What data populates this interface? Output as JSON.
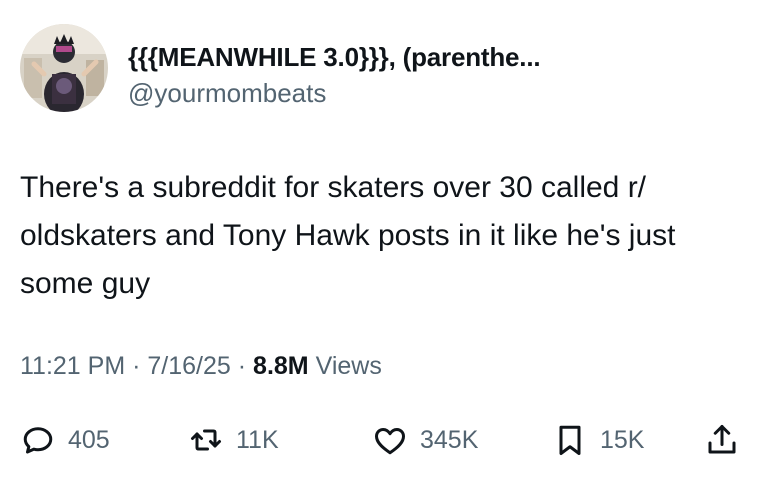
{
  "author": {
    "display_name": "{{{MEANWHILE 3.0}}}, (parenthe...",
    "handle": "@yourmombeats",
    "avatar_icon": "user-avatar-photo"
  },
  "tweet": {
    "text": "There's a subreddit for skaters over 30 called r/ oldskaters and Tony Hawk posts in it like he's just some guy"
  },
  "meta": {
    "time": "11:21 PM",
    "separator": "·",
    "date": "7/16/25",
    "views_count": "8.8M",
    "views_label": "Views"
  },
  "actions": {
    "replies": "405",
    "reposts": "11K",
    "likes": "345K",
    "bookmarks": "15K"
  },
  "colors": {
    "text_primary": "#0f1419",
    "text_secondary": "#536471",
    "background": "#ffffff"
  }
}
